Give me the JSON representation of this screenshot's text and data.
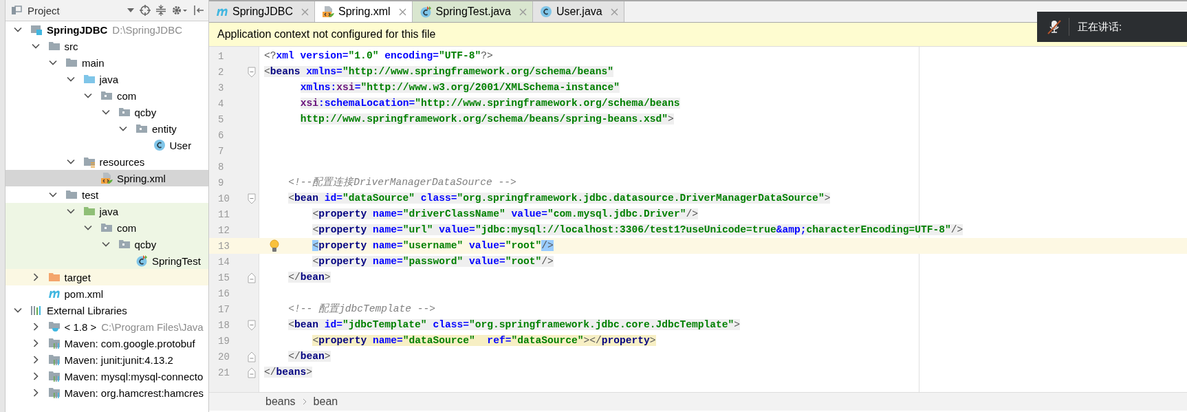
{
  "project_panel": {
    "title": "Project",
    "tree": [
      {
        "label": "SpringJDBC",
        "hint": "D:\\SpringJDBC",
        "kind": "module",
        "expanded": true,
        "selected": false,
        "children": [
          {
            "label": "src",
            "kind": "folder",
            "expanded": true,
            "selected": false,
            "children": [
              {
                "label": "main",
                "kind": "folder",
                "expanded": true,
                "selected": false,
                "children": [
                  {
                    "label": "java",
                    "kind": "source",
                    "expanded": true,
                    "selected": false,
                    "children": [
                      {
                        "label": "com",
                        "kind": "package",
                        "expanded": true,
                        "selected": false,
                        "children": [
                          {
                            "label": "qcby",
                            "kind": "package",
                            "expanded": true,
                            "selected": false,
                            "children": [
                              {
                                "label": "entity",
                                "kind": "package",
                                "expanded": true,
                                "selected": false,
                                "children": [
                                  {
                                    "label": "User",
                                    "kind": "class",
                                    "selected": false
                                  }
                                ]
                              }
                            ]
                          }
                        ]
                      }
                    ]
                  },
                  {
                    "label": "resources",
                    "kind": "resources",
                    "expanded": true,
                    "selected": false,
                    "children": [
                      {
                        "label": "Spring.xml",
                        "kind": "xml",
                        "selected": true
                      }
                    ]
                  }
                ]
              },
              {
                "label": "test",
                "kind": "folder",
                "expanded": true,
                "selected": false,
                "children": [
                  {
                    "label": "java",
                    "kind": "testsource",
                    "test": true,
                    "expanded": true,
                    "selected": false,
                    "children": [
                      {
                        "label": "com",
                        "kind": "package",
                        "test": true,
                        "expanded": true,
                        "selected": false,
                        "children": [
                          {
                            "label": "qcby",
                            "kind": "package",
                            "test": true,
                            "expanded": true,
                            "selected": false,
                            "children": [
                              {
                                "label": "SpringTest",
                                "kind": "testclass",
                                "test": true,
                                "selected": false
                              }
                            ]
                          }
                        ]
                      }
                    ]
                  }
                ]
              }
            ]
          },
          {
            "label": "target",
            "kind": "excluded",
            "excluded": true,
            "expanded": false,
            "selected": false
          },
          {
            "label": "pom.xml",
            "kind": "maven",
            "selected": false
          }
        ]
      },
      {
        "label": "External Libraries",
        "kind": "libraries",
        "expanded": true,
        "selected": false,
        "children": [
          {
            "label": "< 1.8 >",
            "hint": "C:\\Program Files\\Java",
            "kind": "jdk",
            "expanded": false,
            "selected": false
          },
          {
            "label": "Maven: com.google.protobuf",
            "kind": "library",
            "expanded": false,
            "selected": false
          },
          {
            "label": "Maven: junit:junit:4.13.2",
            "kind": "library",
            "expanded": false,
            "selected": false
          },
          {
            "label": "Maven: mysql:mysql-connecto",
            "kind": "library",
            "expanded": false,
            "selected": false
          },
          {
            "label": "Maven: org.hamcrest:hamcres",
            "kind": "library",
            "expanded": false,
            "selected": false
          }
        ]
      }
    ]
  },
  "tabs": [
    {
      "label": "SpringJDBC",
      "kind": "maven",
      "selected": false
    },
    {
      "label": "Spring.xml",
      "kind": "xml",
      "selected": true
    },
    {
      "label": "SpringTest.java",
      "kind": "testclass",
      "test": true,
      "selected": false
    },
    {
      "label": "User.java",
      "kind": "class",
      "selected": false
    }
  ],
  "banner": "Application context not configured for this file",
  "editor": {
    "lines": [
      {
        "number": "1",
        "kind": "root",
        "tokens": [
          {
            "kind": "punct",
            "text": "<?"
          },
          {
            "kind": "attr",
            "text": "xml version="
          },
          {
            "kind": "value",
            "text": "\"1.0\""
          },
          {
            "kind": "attr",
            "text": " encoding="
          },
          {
            "kind": "value",
            "text": "\"UTF-8\""
          },
          {
            "kind": "punct",
            "text": "?>"
          }
        ]
      },
      {
        "number": "2",
        "kind": "root",
        "shaded": true,
        "fold_start": true,
        "tokens": [
          {
            "kind": "punct",
            "text": "<"
          },
          {
            "kind": "tag",
            "text": "beans"
          },
          {
            "kind": "attr",
            "text": " xmlns="
          },
          {
            "kind": "value",
            "text": "\"http://www.springframework.org/schema/beans\""
          }
        ]
      },
      {
        "number": "3",
        "kind": "attribute",
        "shaded": true,
        "tokens": [
          {
            "kind": "attr",
            "text": "xmlns:"
          },
          {
            "kind": "ns",
            "text": "xsi"
          },
          {
            "kind": "attr",
            "text": "="
          },
          {
            "kind": "value",
            "text": "\"http://www.w3.org/2001/XMLSchema-instance\""
          }
        ]
      },
      {
        "number": "4",
        "kind": "attribute",
        "shaded": true,
        "tokens": [
          {
            "kind": "ns",
            "text": "xsi"
          },
          {
            "kind": "attr",
            "text": ":schemaLocation="
          },
          {
            "kind": "value",
            "text": "\"http://www.springframework.org/schema/beans"
          }
        ]
      },
      {
        "number": "5",
        "kind": "attribute",
        "shaded": true,
        "tokens": [
          {
            "kind": "value",
            "text": "http://www.springframework.org/schema/beans/spring-beans.xsd\""
          },
          {
            "kind": "punct",
            "text": ">"
          }
        ]
      },
      {
        "number": "6"
      },
      {
        "number": "7"
      },
      {
        "number": "8"
      },
      {
        "number": "9",
        "kind": "child",
        "tokens": [
          {
            "kind": "comment",
            "text": "<!--配置连接DriverManagerDataSource -->"
          }
        ]
      },
      {
        "number": "10",
        "kind": "child",
        "shaded": true,
        "fold_start": true,
        "tokens": [
          {
            "kind": "punct",
            "text": "<"
          },
          {
            "kind": "tag",
            "text": "bean"
          },
          {
            "kind": "attr",
            "text": " id="
          },
          {
            "kind": "value",
            "text": "\"dataSource\""
          },
          {
            "kind": "attr",
            "text": " class="
          },
          {
            "kind": "value",
            "text": "\"org.springframework.jdbc.datasource.DriverManagerDataSource\""
          },
          {
            "kind": "punct",
            "text": ">"
          }
        ]
      },
      {
        "number": "11",
        "kind": "grandchild",
        "shaded": true,
        "tokens": [
          {
            "kind": "punct",
            "text": "<"
          },
          {
            "kind": "tag",
            "text": "property"
          },
          {
            "kind": "attr",
            "text": " name="
          },
          {
            "kind": "value",
            "text": "\"driverClassName\""
          },
          {
            "kind": "attr",
            "text": " value="
          },
          {
            "kind": "value",
            "text": "\"com.mysql.jdbc.Driver\""
          },
          {
            "kind": "punct",
            "text": "/>"
          }
        ]
      },
      {
        "number": "12",
        "kind": "grandchild",
        "shaded": true,
        "tokens": [
          {
            "kind": "punct",
            "text": "<"
          },
          {
            "kind": "tag",
            "text": "property"
          },
          {
            "kind": "attr",
            "text": " name="
          },
          {
            "kind": "value",
            "text": "\"url\""
          },
          {
            "kind": "attr",
            "text": " value="
          },
          {
            "kind": "value",
            "text": "\"jdbc:mysql://localhost:3306/test1?useUnicode=true"
          },
          {
            "kind": "entity",
            "text": "&amp;"
          },
          {
            "kind": "value",
            "text": "characterEncoding=UTF-8\""
          },
          {
            "kind": "punct",
            "text": "/>"
          }
        ]
      },
      {
        "number": "13",
        "kind": "grandchild",
        "current": true,
        "bulb": true,
        "tokens": [
          {
            "kind": "punct",
            "text": "<",
            "matched": true
          },
          {
            "kind": "tag",
            "text": "property"
          },
          {
            "kind": "attr",
            "text": " name="
          },
          {
            "kind": "value",
            "text": "\"username\""
          },
          {
            "kind": "attr",
            "text": " value="
          },
          {
            "kind": "value",
            "text": "\"root\""
          },
          {
            "kind": "punct",
            "text": "/>",
            "matched": true
          }
        ]
      },
      {
        "number": "14",
        "kind": "grandchild",
        "shaded": true,
        "tokens": [
          {
            "kind": "punct",
            "text": "<"
          },
          {
            "kind": "tag",
            "text": "property"
          },
          {
            "kind": "attr",
            "text": " name="
          },
          {
            "kind": "value",
            "text": "\"password\""
          },
          {
            "kind": "attr",
            "text": " value="
          },
          {
            "kind": "value",
            "text": "\"root\""
          },
          {
            "kind": "punct",
            "text": "/>"
          }
        ]
      },
      {
        "number": "15",
        "kind": "child",
        "shaded": true,
        "fold_end": true,
        "tokens": [
          {
            "kind": "punct",
            "text": "</"
          },
          {
            "kind": "tag",
            "text": "bean"
          },
          {
            "kind": "punct",
            "text": ">"
          }
        ]
      },
      {
        "number": "16"
      },
      {
        "number": "17",
        "kind": "child",
        "tokens": [
          {
            "kind": "comment",
            "text": "<!-- 配置jdbcTemplate -->"
          }
        ]
      },
      {
        "number": "18",
        "kind": "child",
        "shaded": true,
        "fold_start": true,
        "tokens": [
          {
            "kind": "punct",
            "text": "<"
          },
          {
            "kind": "tag",
            "text": "bean"
          },
          {
            "kind": "attr",
            "text": " id="
          },
          {
            "kind": "value",
            "text": "\"jdbcTemplate\""
          },
          {
            "kind": "attr",
            "text": " class="
          },
          {
            "kind": "value",
            "text": "\"org.springframework.jdbc.core.JdbcTemplate\""
          },
          {
            "kind": "punct",
            "text": ">"
          }
        ]
      },
      {
        "number": "19",
        "kind": "grandchild",
        "warning": true,
        "tokens": [
          {
            "kind": "punct",
            "text": "<"
          },
          {
            "kind": "tag",
            "text": "property"
          },
          {
            "kind": "attr",
            "text": " name="
          },
          {
            "kind": "value",
            "text": "\"dataSource\""
          },
          {
            "kind": "attr",
            "text": "  ref="
          },
          {
            "kind": "value",
            "text": "\"dataSource\""
          },
          {
            "kind": "punct",
            "text": "></"
          },
          {
            "kind": "tag",
            "text": "property"
          },
          {
            "kind": "punct",
            "text": ">"
          }
        ]
      },
      {
        "number": "20",
        "kind": "child",
        "shaded": true,
        "fold_end": true,
        "tokens": [
          {
            "kind": "punct",
            "text": "</"
          },
          {
            "kind": "tag",
            "text": "bean"
          },
          {
            "kind": "punct",
            "text": ">"
          }
        ]
      },
      {
        "number": "21",
        "kind": "root",
        "shaded": true,
        "fold_end": true,
        "tokens": [
          {
            "kind": "punct",
            "text": "</"
          },
          {
            "kind": "tag",
            "text": "beans"
          },
          {
            "kind": "punct",
            "text": ">"
          }
        ]
      }
    ]
  },
  "breadcrumbs": [
    "beans",
    "bean"
  ],
  "toast": {
    "text": "正在讲话:"
  }
}
